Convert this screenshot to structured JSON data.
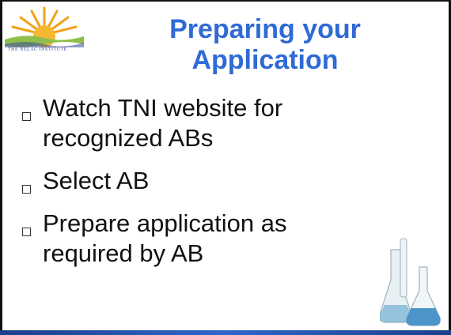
{
  "logo": {
    "org_text": "THE NELAC INSTITUTE",
    "colors": {
      "sun": "#f2a21b",
      "wave": "#8fbf4a",
      "wave_dark": "#3a4a9a"
    }
  },
  "slide": {
    "title_line1": "Preparing your",
    "title_line2": "Application",
    "title_color": "#2f6ad6",
    "bullets": [
      {
        "line1": "Watch TNI website for",
        "line2": "recognized ABs"
      },
      {
        "line1": "Select AB",
        "line2": ""
      },
      {
        "line1": "Prepare application as",
        "line2": "required by AB"
      }
    ]
  },
  "decor": {
    "image": "lab-flasks-icon",
    "bottom_bar_color": "#2f66c8"
  }
}
